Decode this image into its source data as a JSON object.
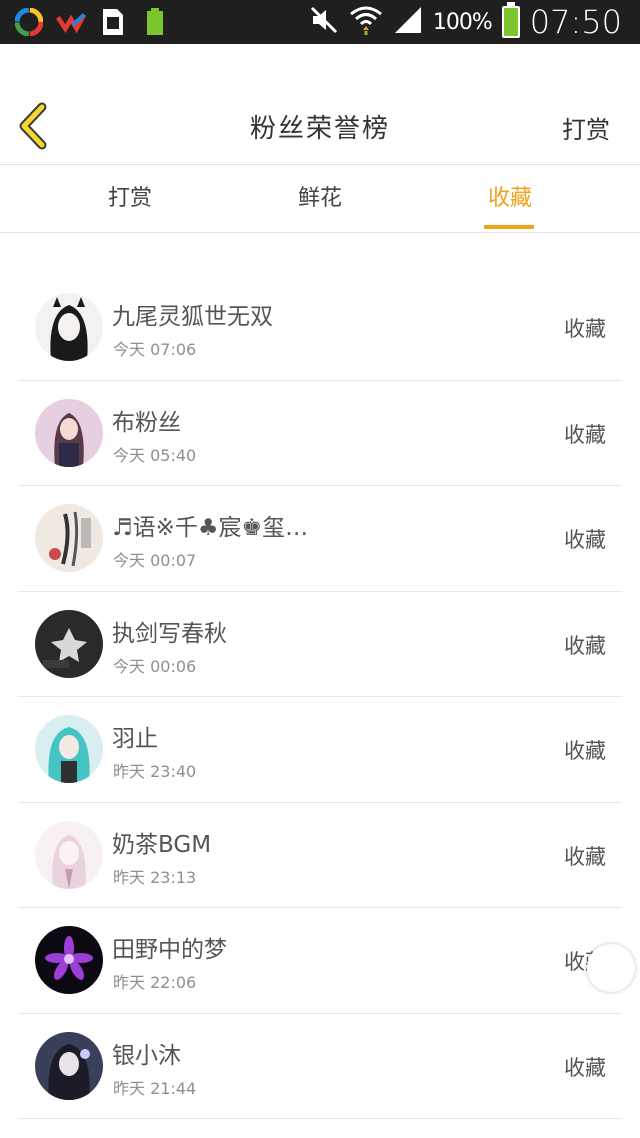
{
  "status_bar": {
    "battery_percent": "100%",
    "time": "07:50",
    "icons": [
      "app-icon-colorful",
      "app-icon-red-check",
      "sim-icon",
      "battery-small-icon",
      "mute-icon",
      "wifi-icon",
      "signal-icon",
      "battery-icon"
    ]
  },
  "header": {
    "title": "粉丝荣誉榜",
    "right_action": "打赏"
  },
  "tabs": [
    {
      "label": "打赏"
    },
    {
      "label": "鲜花"
    },
    {
      "label": "收藏"
    }
  ],
  "active_tab_index": 2,
  "accent_color": "#f0a21a",
  "fans": [
    {
      "name": "九尾灵狐世无双",
      "time": "今天 07:06",
      "action": "收藏"
    },
    {
      "name": "布粉丝",
      "time": "今天 05:40",
      "action": "收藏"
    },
    {
      "name": "♬语※千♣宸♚玺…",
      "time": "今天 00:07",
      "action": "收藏"
    },
    {
      "name": "执剑写春秋",
      "time": "今天 00:06",
      "action": "收藏"
    },
    {
      "name": "羽止",
      "time": "昨天 23:40",
      "action": "收藏"
    },
    {
      "name": "奶茶BGM",
      "time": "昨天 23:13",
      "action": "收藏"
    },
    {
      "name": "田野中的梦",
      "time": "昨天 22:06",
      "action": "收藏"
    },
    {
      "name": "银小沐",
      "time": "昨天 21:44",
      "action": "收藏"
    }
  ]
}
